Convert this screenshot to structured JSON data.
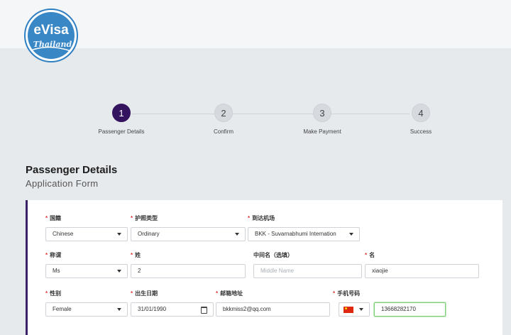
{
  "logo": {
    "line1": "eVisa",
    "line2": "Thailand"
  },
  "stepper": {
    "steps": [
      {
        "number": "1",
        "label": "Passenger Details",
        "active": true
      },
      {
        "number": "2",
        "label": "Confirm",
        "active": false
      },
      {
        "number": "3",
        "label": "Make Payment",
        "active": false
      },
      {
        "number": "4",
        "label": "Success",
        "active": false
      }
    ]
  },
  "heading": {
    "title": "Passenger Details",
    "subtitle": "Application Form"
  },
  "form": {
    "required_mark": "*",
    "nationality": {
      "label": "国籍",
      "value": "Chinese"
    },
    "passport_type": {
      "label": "护照类型",
      "value": "Ordinary"
    },
    "arrival_airport": {
      "label": "到达机场",
      "value": "BKK - Suvarnabhumi Internation"
    },
    "title": {
      "label": "称谓",
      "value": "Ms"
    },
    "surname": {
      "label": "姓",
      "value": "2"
    },
    "middle_name": {
      "label": "中间名（选填）",
      "value": "",
      "placeholder": "Middle Name"
    },
    "given_name": {
      "label": "名",
      "value": "xiaojie"
    },
    "gender": {
      "label": "性别",
      "value": "Female"
    },
    "birth_date": {
      "label": "出生日期",
      "value": "31/01/1990"
    },
    "email": {
      "label": "邮箱地址",
      "value": "bkkmiss2@qq.com"
    },
    "phone": {
      "label": "手机号码",
      "country_flag": "china-flag-icon",
      "value": "13668282170"
    }
  },
  "colors": {
    "accent": "#34145f",
    "required": "#e23a3a",
    "focus_border": "#7ed07a",
    "logo_blue": "#2e7fc2"
  }
}
